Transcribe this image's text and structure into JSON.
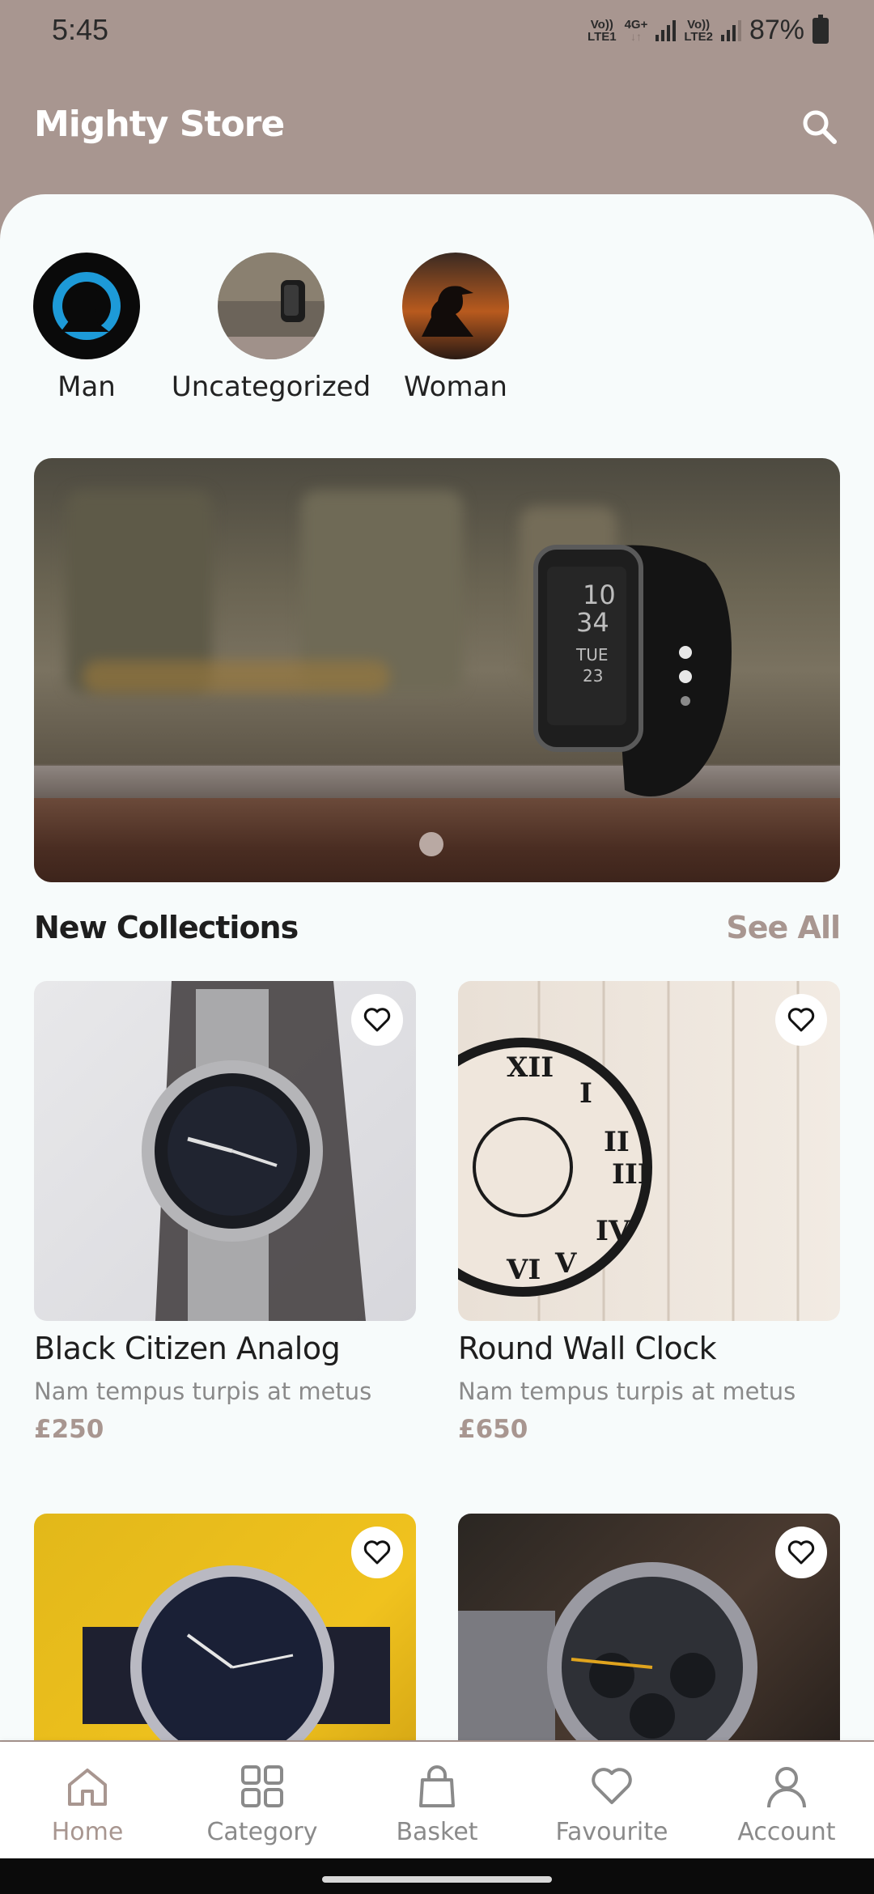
{
  "status_bar": {
    "time": "5:45",
    "sim1_line1": "Vo))",
    "sim1_line2": "LTE1",
    "network": "4G+",
    "sim2_line1": "Vo))",
    "sim2_line2": "LTE2",
    "battery": "87%"
  },
  "header": {
    "title": "Mighty Store",
    "search_icon": "search-icon"
  },
  "categories": [
    {
      "label": "Man"
    },
    {
      "label": "Uncategorized"
    },
    {
      "label": "Woman"
    }
  ],
  "banner": {
    "watch_time_hours": "10",
    "watch_time_minutes": "34",
    "watch_day": "TUE",
    "watch_date": "23",
    "carousel_active_index": 1,
    "carousel_count": 2
  },
  "new_collections": {
    "title": "New Collections",
    "see_all": "See All"
  },
  "products": [
    {
      "name": "Black Citizen Analog",
      "description": "Nam tempus turpis at metus",
      "price": "£250"
    },
    {
      "name": "Round Wall Clock",
      "description": "Nam tempus turpis at metus",
      "price": "£650"
    },
    {
      "name": "",
      "description": "",
      "price": ""
    },
    {
      "name": "",
      "description": "",
      "price": ""
    }
  ],
  "bottom_nav": [
    {
      "label": "Home",
      "icon": "home-icon",
      "active": true
    },
    {
      "label": "Category",
      "icon": "grid-icon",
      "active": false
    },
    {
      "label": "Basket",
      "icon": "bag-icon",
      "active": false
    },
    {
      "label": "Favourite",
      "icon": "heart-icon",
      "active": false
    },
    {
      "label": "Account",
      "icon": "user-icon",
      "active": false
    }
  ],
  "colors": {
    "brand": "#a89690",
    "background": "#f7fbfb",
    "text": "#1e1e1e",
    "muted": "#8a8a8a"
  }
}
